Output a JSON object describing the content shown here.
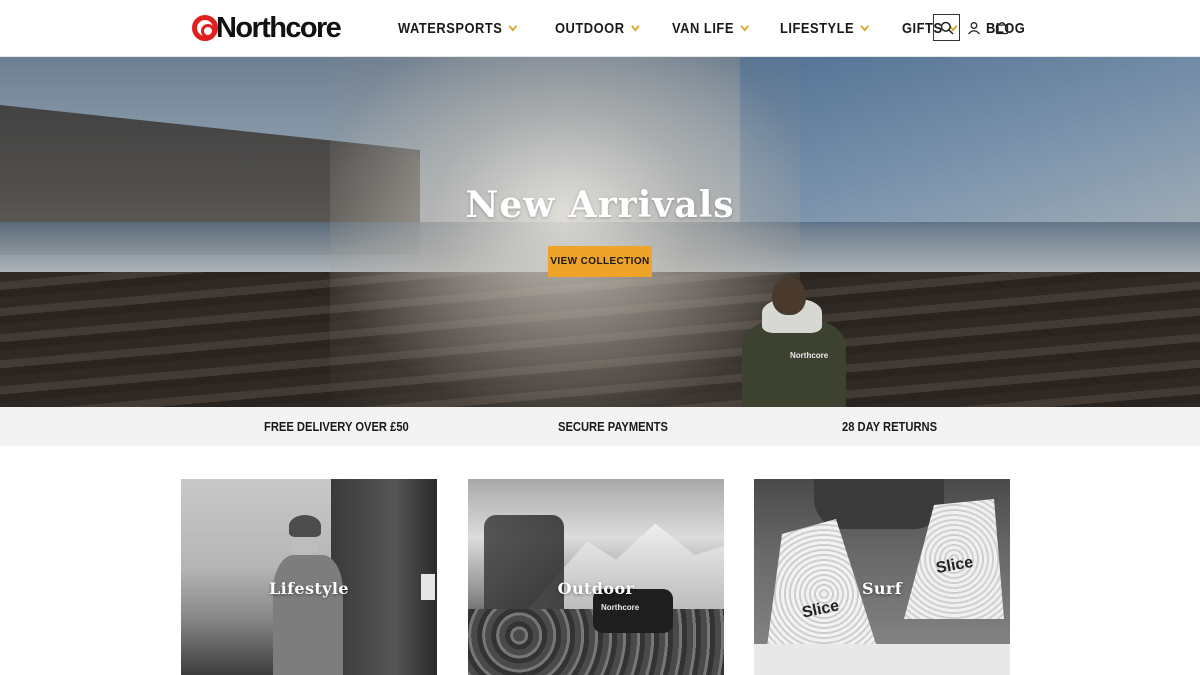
{
  "header": {
    "logo_text": "Northcore",
    "nav": [
      {
        "label": "WATERSPORTS",
        "has_dropdown": true
      },
      {
        "label": "OUTDOOR",
        "has_dropdown": true
      },
      {
        "label": "VAN LIFE",
        "has_dropdown": true
      },
      {
        "label": "LIFESTYLE",
        "has_dropdown": true
      },
      {
        "label": "GIFTS",
        "has_dropdown": true
      },
      {
        "label": "BLOG",
        "has_dropdown": false
      }
    ],
    "icons": [
      "search-icon",
      "account-icon",
      "cart-icon"
    ]
  },
  "hero": {
    "title": "New Arrivals",
    "button_label": "VIEW COLLECTION",
    "jacket_brand": "Northcore"
  },
  "usp": [
    {
      "label": "FREE DELIVERY OVER £50"
    },
    {
      "label": "SECURE PAYMENTS"
    },
    {
      "label": "28 DAY RETURNS"
    }
  ],
  "categories": [
    {
      "label": "Lifestyle"
    },
    {
      "label": "Outdoor",
      "bag_brand": "Northcore"
    },
    {
      "label": "Surf",
      "fin_brand": "Slice"
    }
  ],
  "colors": {
    "accent": "#f0a329",
    "chevron": "#d9a62a",
    "logo_red": "#e02020",
    "usp_bg": "#f3f3f3"
  }
}
